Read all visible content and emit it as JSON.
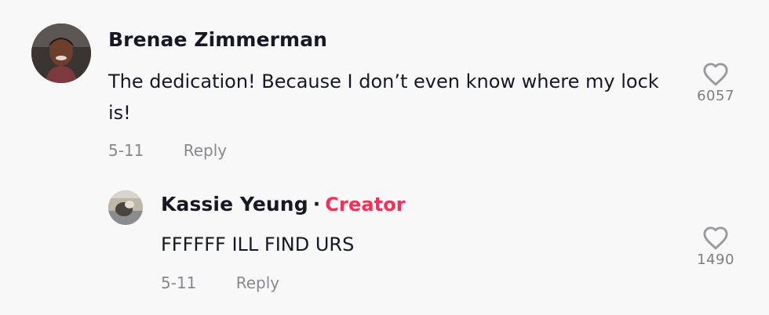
{
  "comments": [
    {
      "author": "Brenae Zimmerman",
      "text": "The dedication! Because I don’t even know where my lock is!",
      "date": "5-11",
      "reply_label": "Reply",
      "like_count": "6057"
    }
  ],
  "replies": [
    {
      "author": "Kassie Yeung",
      "separator": "·",
      "badge": "Creator",
      "text": "FFFFFF ILL FIND URS",
      "date": "5-11",
      "reply_label": "Reply",
      "like_count": "1490"
    }
  ],
  "colors": {
    "background": "#f8f8f8",
    "text_primary": "#161823",
    "creator_badge": "#fe2c55"
  },
  "icons": {
    "like": "heart-outline-icon"
  }
}
